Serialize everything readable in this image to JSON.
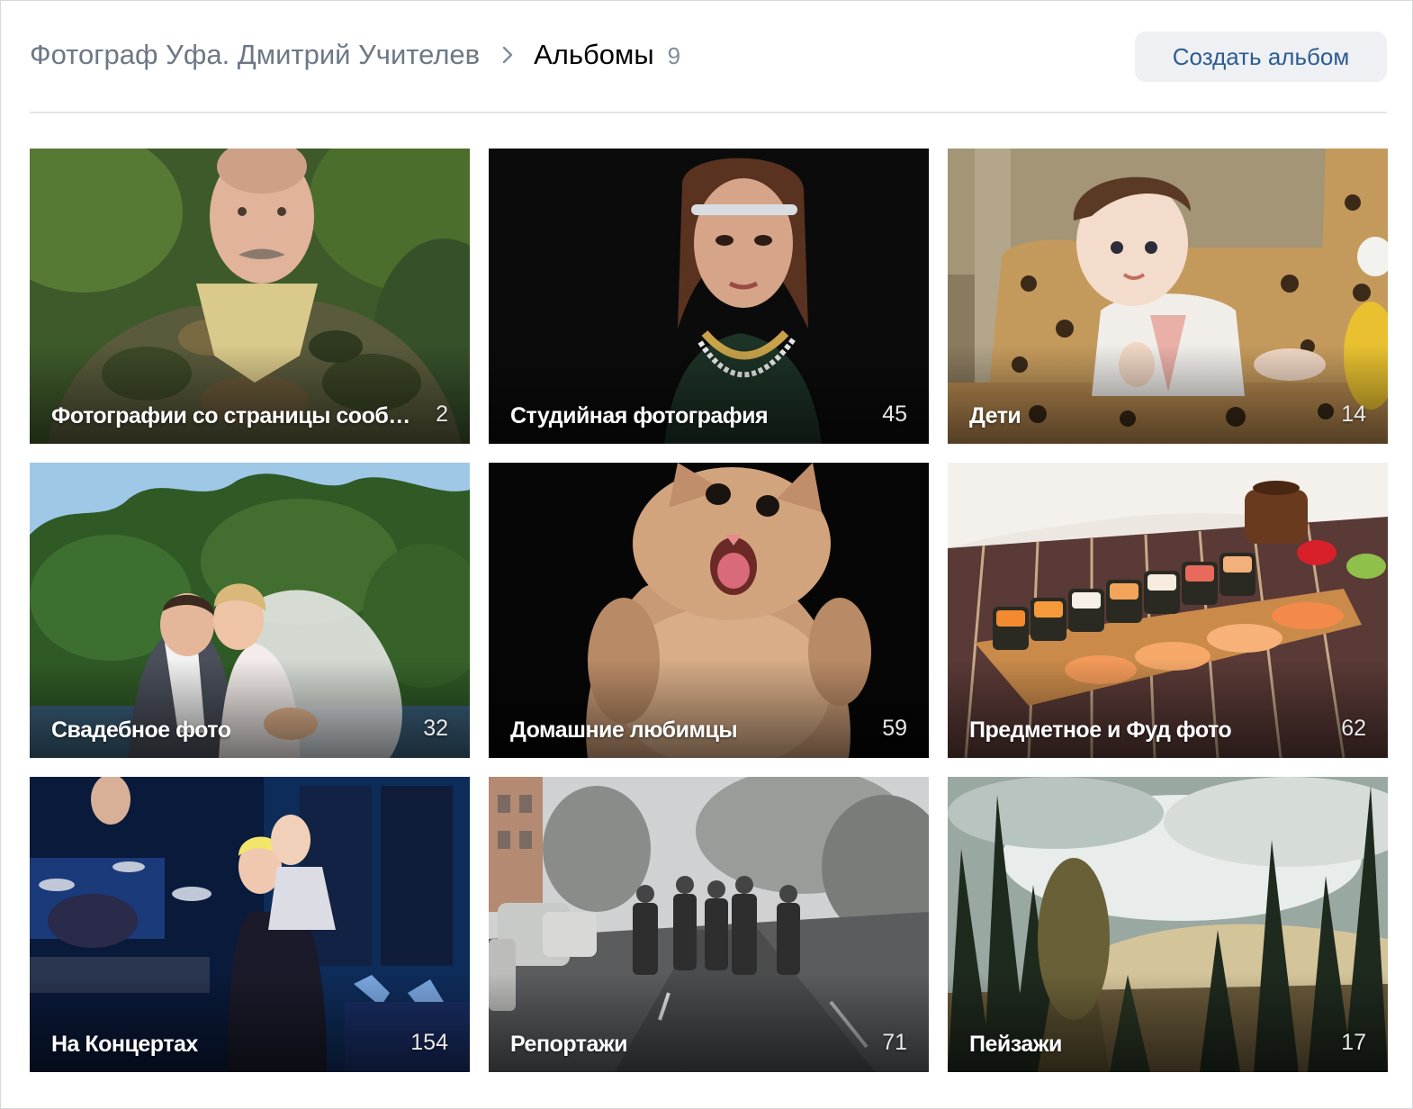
{
  "header": {
    "parent_label": "Фотограф Уфа. Дмитрий Учителев",
    "separator_icon": "chevron-right-icon",
    "current_label": "Альбомы",
    "current_count": "9",
    "create_button_label": "Создать альбом"
  },
  "colors": {
    "accent": "#2c5d8f",
    "muted_text": "#6d7885",
    "button_bg": "#eef0f4",
    "divider": "#e4e6ea"
  },
  "albums": [
    {
      "title": "Фотографии со страницы сообщ...",
      "count": "2",
      "cover": "man-in-camouflage"
    },
    {
      "title": "Студийная фотография",
      "count": "45",
      "cover": "studio-portrait-woman"
    },
    {
      "title": "Дети",
      "count": "14",
      "cover": "baby-on-leopard-chair"
    },
    {
      "title": "Свадебное фото",
      "count": "32",
      "cover": "wedding-couple-kiss"
    },
    {
      "title": "Домашние любимцы",
      "count": "59",
      "cover": "fluffy-cat"
    },
    {
      "title": "Предметное и Фуд фото",
      "count": "62",
      "cover": "sushi-plate"
    },
    {
      "title": "На Концертах",
      "count": "154",
      "cover": "concert-stage"
    },
    {
      "title": "Репортажи",
      "count": "71",
      "cover": "soldiers-march-street"
    },
    {
      "title": "Пейзажи",
      "count": "17",
      "cover": "forest-landscape"
    }
  ]
}
